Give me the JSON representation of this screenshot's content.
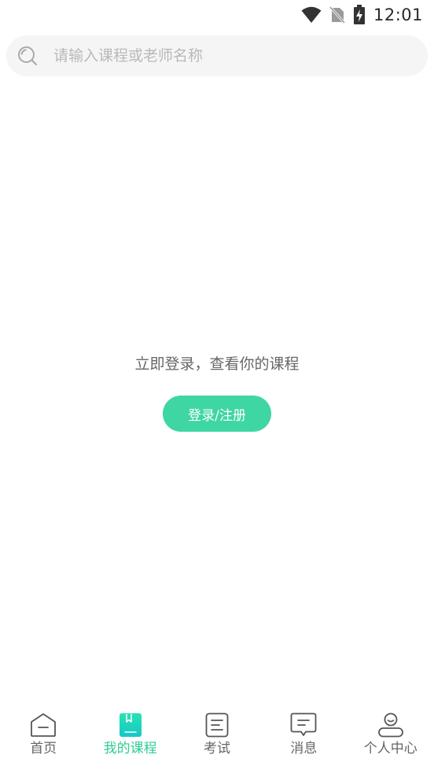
{
  "status_bar": {
    "time": "12:01",
    "icons": [
      "wifi-icon",
      "no-sim-icon",
      "battery-charging-icon"
    ]
  },
  "search": {
    "placeholder": "请输入课程或老师名称",
    "icon": "search-icon"
  },
  "empty_state": {
    "message": "立即登录，查看你的课程",
    "login_button": "登录/注册"
  },
  "bottom_nav": {
    "active_index": 1,
    "items": [
      {
        "label": "首页",
        "icon": "home-icon"
      },
      {
        "label": "我的课程",
        "icon": "book-icon"
      },
      {
        "label": "考试",
        "icon": "exam-doc-icon"
      },
      {
        "label": "消息",
        "icon": "message-icon"
      },
      {
        "label": "个人中心",
        "icon": "profile-icon"
      }
    ]
  },
  "colors": {
    "accent": "#3ed6a2",
    "active_nav": "#2fcc93",
    "inactive_nav": "#666666",
    "search_bg": "#f5f5f5"
  }
}
